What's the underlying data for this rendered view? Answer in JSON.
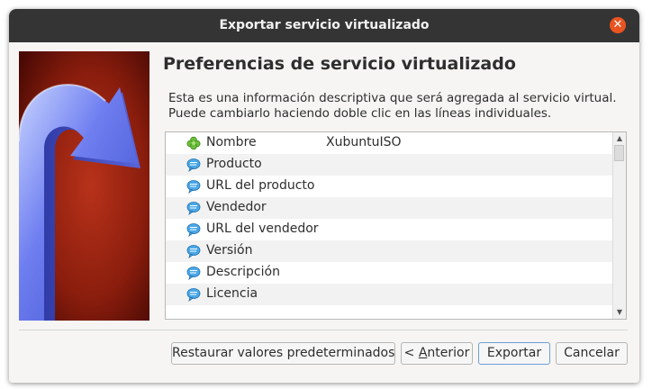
{
  "window": {
    "title": "Exportar servicio virtualizado"
  },
  "page": {
    "heading": "Preferencias de servicio virtualizado",
    "description_lines": [
      "Esta es una información descriptiva que será agregada al servicio virtual.",
      "Puede cambiarlo haciendo doble clic en las líneas individuales."
    ]
  },
  "properties": [
    {
      "label": "Nombre",
      "value": "XubuntuISO",
      "icon": "name-clover-icon"
    },
    {
      "label": "Producto",
      "value": "",
      "icon": "speech-bubble-icon"
    },
    {
      "label": "URL del producto",
      "value": "",
      "icon": "speech-bubble-icon"
    },
    {
      "label": "Vendedor",
      "value": "",
      "icon": "speech-bubble-icon"
    },
    {
      "label": "URL del vendedor",
      "value": "",
      "icon": "speech-bubble-icon"
    },
    {
      "label": "Versión",
      "value": "",
      "icon": "speech-bubble-icon"
    },
    {
      "label": "Descripción",
      "value": "",
      "icon": "speech-bubble-icon"
    },
    {
      "label": "Licencia",
      "value": "",
      "icon": "speech-bubble-icon"
    }
  ],
  "buttons": {
    "restore": "Restaurar valores predeterminados",
    "back_prefix": "< ",
    "back_mnemonic": "A",
    "back_rest": "nterior",
    "export": "Exportar",
    "cancel": "Cancelar"
  },
  "colors": {
    "titlebar": "#343434",
    "close_button": "#e95420",
    "dialog_bg": "#f6f5f4",
    "default_button_border": "#6e9fd6"
  }
}
